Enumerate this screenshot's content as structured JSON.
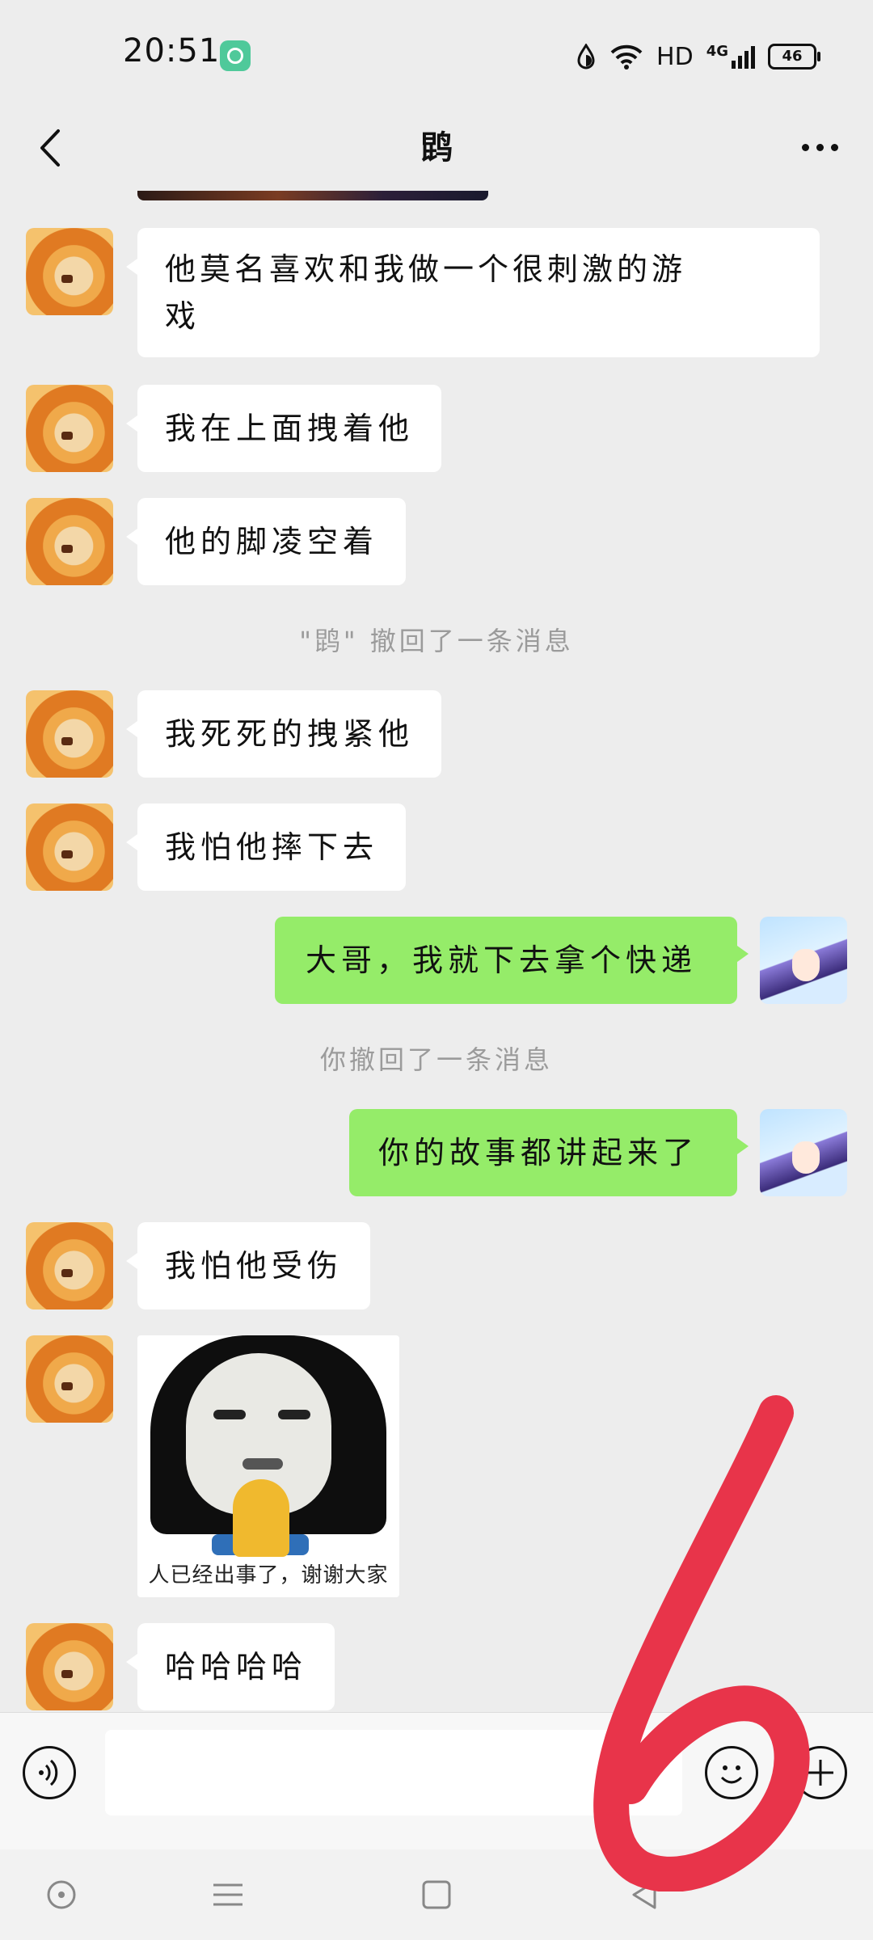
{
  "status_bar": {
    "time": "20:51",
    "network": "HD",
    "signal": "4G",
    "battery": "46"
  },
  "header": {
    "title": "鹍"
  },
  "messages": [
    {
      "side": "left",
      "text_lines": [
        "他莫名喜欢和我做一个很刺激的游",
        "戏"
      ]
    },
    {
      "side": "left",
      "text": "我在上面拽着他"
    },
    {
      "side": "left",
      "text": "他的脚凌空着"
    },
    {
      "system": "\"鹍\" 撤回了一条消息"
    },
    {
      "side": "left",
      "text": "我死死的拽紧他"
    },
    {
      "side": "left",
      "text": "我怕他摔下去"
    },
    {
      "side": "right",
      "text": "大哥，我就下去拿个快递"
    },
    {
      "system": "你撤回了一条消息"
    },
    {
      "side": "right",
      "text": "你的故事都讲起来了"
    },
    {
      "side": "left",
      "text": "我怕他受伤"
    },
    {
      "side": "left",
      "sticker_caption": "人已经出事了，谢谢大家"
    },
    {
      "side": "left",
      "text": "哈哈哈哈"
    }
  ],
  "input": {
    "value": "",
    "placeholder": ""
  },
  "colors": {
    "background": "#ededed",
    "bubble_left": "#ffffff",
    "bubble_right": "#95ec69",
    "overlay_stroke": "#e8344a"
  },
  "icons": [
    "back-icon",
    "more-icon",
    "voice-icon",
    "emoji-icon",
    "plus-icon",
    "nav-home-icon",
    "nav-menu-icon",
    "nav-square-icon",
    "nav-back-icon"
  ]
}
